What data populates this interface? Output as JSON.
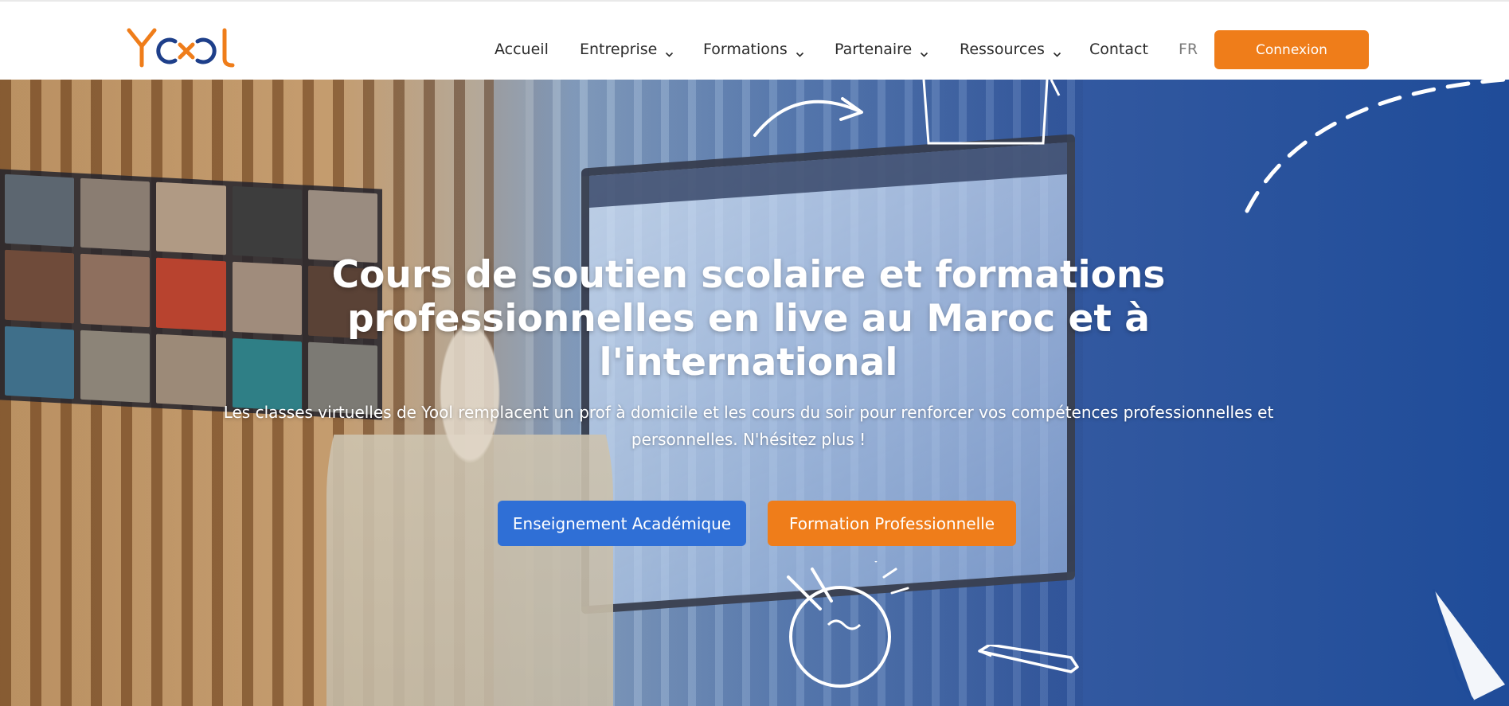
{
  "brand": {
    "logo_text": "Yool",
    "colors": {
      "orange": "#ef7d1a",
      "navy": "#1e3f8a",
      "blue": "#2f6fd6"
    }
  },
  "nav": {
    "items": [
      {
        "label": "Accueil",
        "has_dropdown": false
      },
      {
        "label": "Entreprise",
        "has_dropdown": true
      },
      {
        "label": "Formations",
        "has_dropdown": true
      },
      {
        "label": "Partenaire",
        "has_dropdown": true
      },
      {
        "label": "Ressources",
        "has_dropdown": true
      },
      {
        "label": "Contact",
        "has_dropdown": false
      }
    ],
    "language": "FR",
    "login_label": "Connexion",
    "dropdown_icon": "chevron-down-icon"
  },
  "hero": {
    "title": "Cours de soutien scolaire et formations professionnelles en live au Maroc et à l'international",
    "subtitle": "Les classes virtuelles de Yool remplacent un prof à domicile et les cours du soir pour renforcer vos compétences professionnelles et personnelles. N'hésitez plus !",
    "buttons": {
      "academic": "Enseignement Académique",
      "professional": "Formation Professionnelle"
    }
  }
}
